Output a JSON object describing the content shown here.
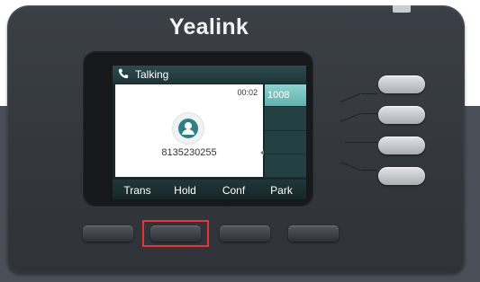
{
  "device": {
    "brand": "Yealink"
  },
  "screen": {
    "status": {
      "icon": "phone-handset-icon",
      "label": "Talking"
    },
    "call": {
      "duration": "00:02",
      "caller_number": "8135230255",
      "avatar_icon": "contact-avatar-icon"
    },
    "line_keys": [
      {
        "label": "1008",
        "active": true
      },
      {
        "label": "",
        "active": false
      },
      {
        "label": "",
        "active": false
      },
      {
        "label": "",
        "active": false
      }
    ],
    "softkeys": [
      {
        "label": "Trans"
      },
      {
        "label": "Hold"
      },
      {
        "label": "Conf"
      },
      {
        "label": "Park"
      }
    ]
  },
  "hardware": {
    "line_buttons": [
      "line-key-1",
      "line-key-2",
      "line-key-3",
      "line-key-4"
    ],
    "soft_buttons": [
      "soft-button-trans",
      "soft-button-hold",
      "soft-button-conf",
      "soft-button-park"
    ],
    "highlighted_soft_button": "soft-button-hold"
  },
  "colors": {
    "body": "#33373d",
    "screen_accent": "#8fd3d0",
    "highlight": "#e53535"
  }
}
